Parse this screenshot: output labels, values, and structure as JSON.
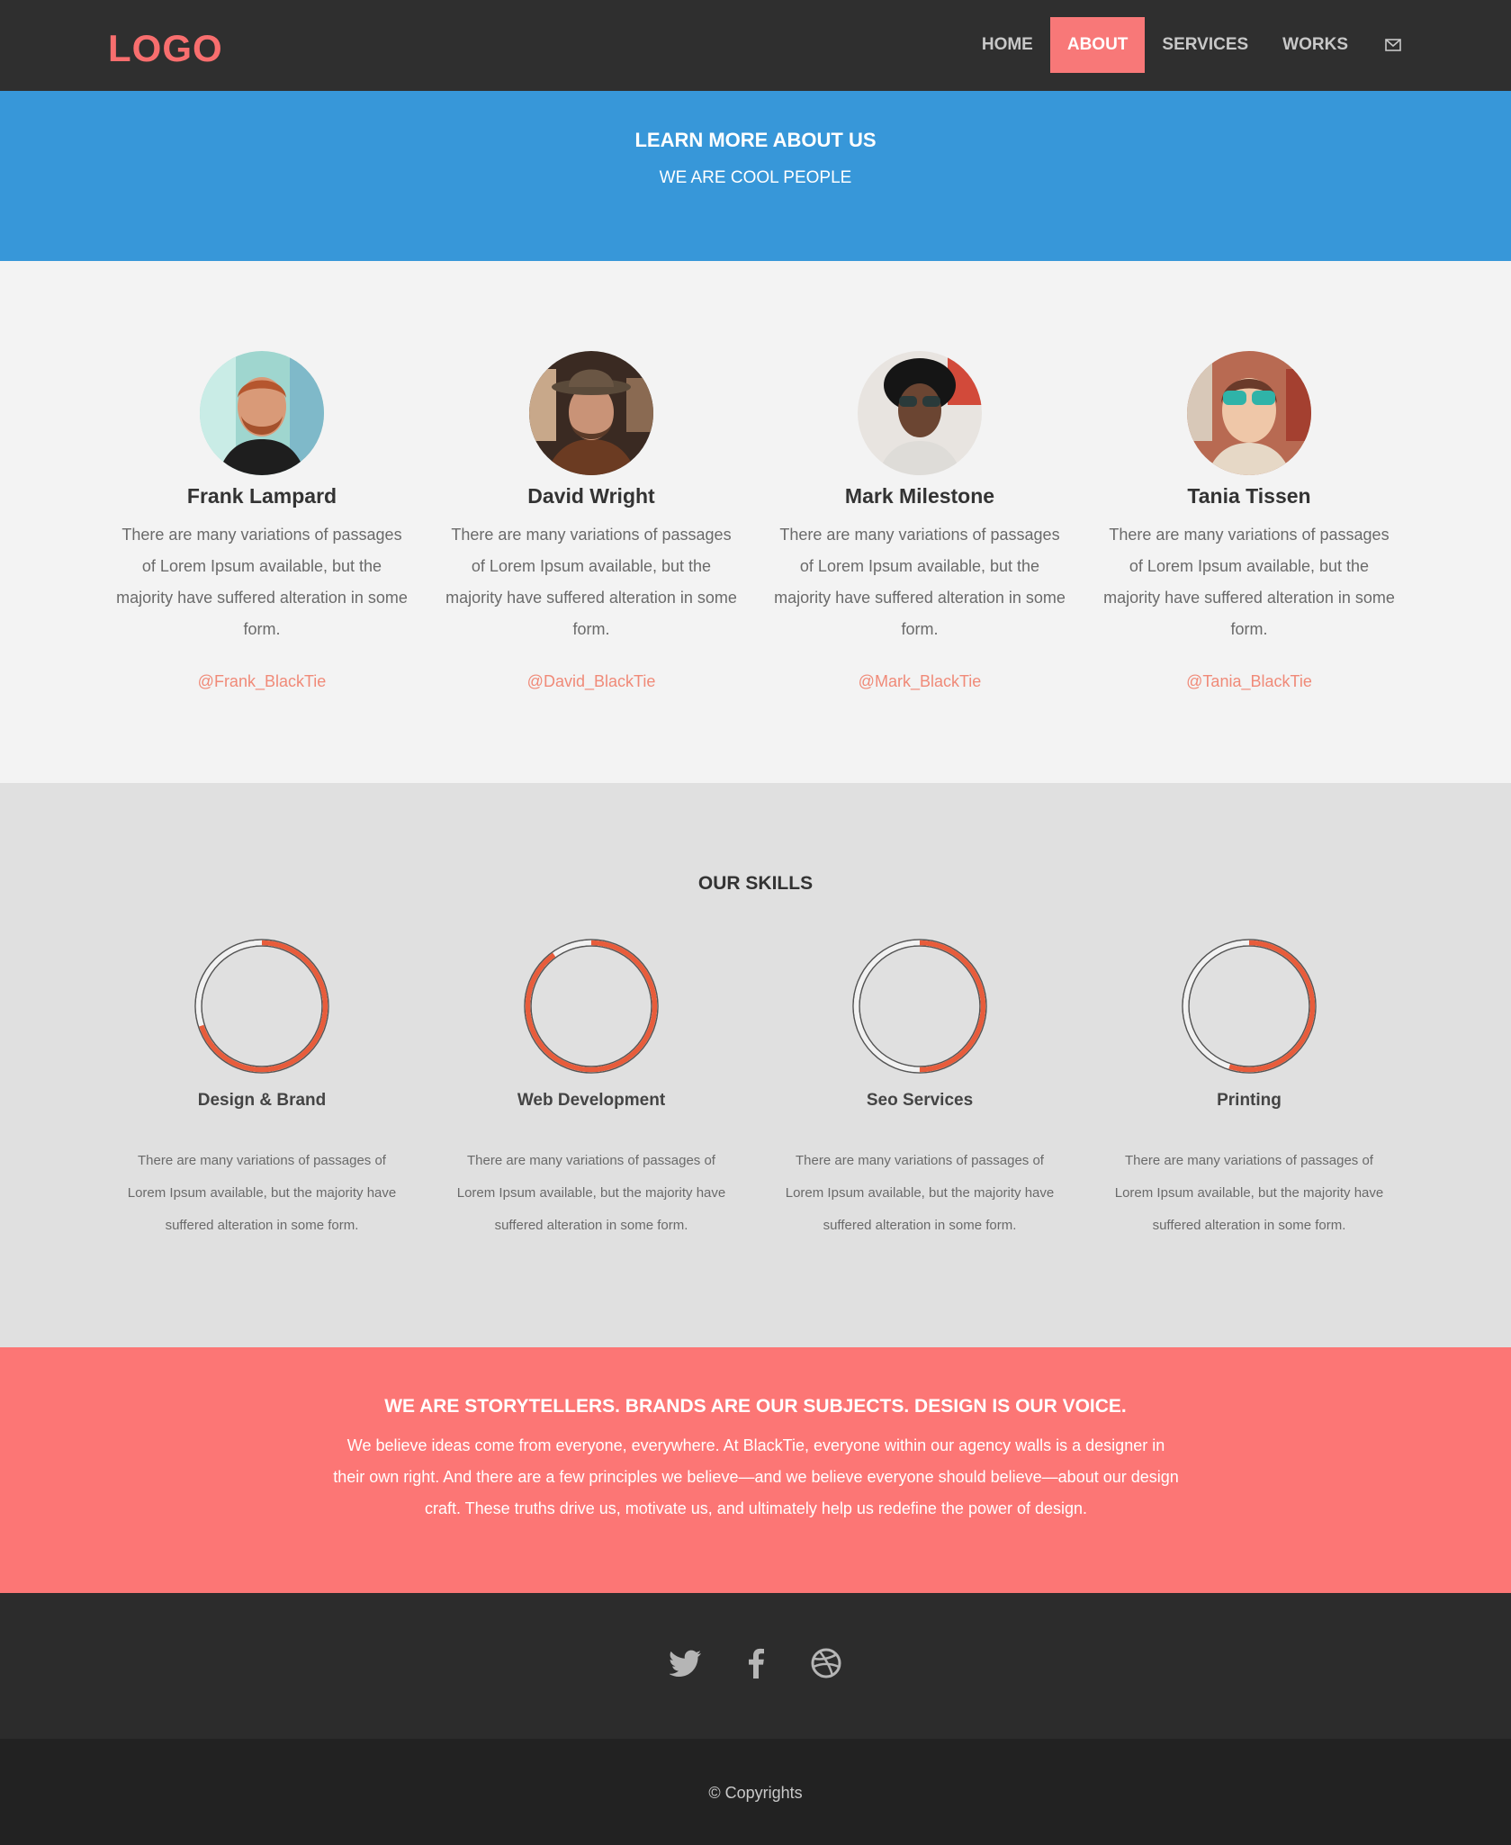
{
  "navbar": {
    "logo": "LOGO",
    "items": [
      {
        "label": "HOME"
      },
      {
        "label": "ABOUT",
        "active": true
      },
      {
        "label": "SERVICES"
      },
      {
        "label": "WORKS"
      }
    ],
    "contact_icon": "envelope-icon"
  },
  "hero": {
    "title": "LEARN MORE ABOUT US",
    "subtitle": "WE ARE COOL PEOPLE"
  },
  "team": {
    "members": [
      {
        "name": "Frank Lampard",
        "bio": "There are many variations of passages of Lorem Ipsum available, but the majority have suffered alteration in some form.",
        "handle": "@Frank_BlackTie"
      },
      {
        "name": "David Wright",
        "bio": "There are many variations of passages of Lorem Ipsum available, but the majority have suffered alteration in some form.",
        "handle": "@David_BlackTie"
      },
      {
        "name": "Mark Milestone",
        "bio": "There are many variations of passages of Lorem Ipsum available, but the majority have suffered alteration in some form.",
        "handle": "@Mark_BlackTie"
      },
      {
        "name": "Tania Tissen",
        "bio": "There are many variations of passages of Lorem Ipsum available, but the majority have suffered alteration in some form.",
        "handle": "@Tania_BlackTie"
      }
    ]
  },
  "skills": {
    "title": "OUR SKILLS",
    "items": [
      {
        "name": "Design & Brand",
        "percent": 70,
        "desc": "There are many variations of passages of Lorem Ipsum available, but the majority have suffered alteration in some form."
      },
      {
        "name": "Web Development",
        "percent": 90,
        "desc": "There are many variations of passages of Lorem Ipsum available, but the majority have suffered alteration in some form."
      },
      {
        "name": "Seo Services",
        "percent": 50,
        "desc": "There are many variations of passages of Lorem Ipsum available, but the majority have suffered alteration in some form."
      },
      {
        "name": "Printing",
        "percent": 55,
        "desc": "There are many variations of passages of Lorem Ipsum available, but the majority have suffered alteration in some form."
      }
    ]
  },
  "story": {
    "title": "WE ARE STORYTELLERS. BRANDS ARE OUR SUBJECTS. DESIGN IS OUR VOICE.",
    "text": "We believe ideas come from everyone, everywhere. At BlackTie, everyone within our agency walls is a designer in their own right. And there are a few principles we believe—and we believe everyone should believe—about our design craft. These truths drive us, motivate us, and ultimately help us redefine the power of design."
  },
  "social": {
    "icons": [
      "twitter-icon",
      "facebook-icon",
      "dribbble-icon"
    ]
  },
  "footer": {
    "copyright": "© Copyrights"
  },
  "colors": {
    "accent": "#f87878",
    "hero": "#3797d9",
    "story": "#fc7675",
    "skill_ring": "#e85c3b"
  }
}
